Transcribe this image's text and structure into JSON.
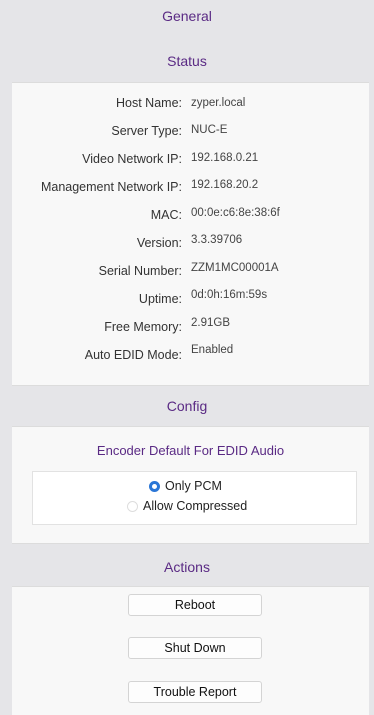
{
  "sections": {
    "general": "General",
    "status": "Status",
    "config": "Config",
    "actions": "Actions"
  },
  "status": {
    "rows": [
      {
        "label": "Host Name:",
        "value": "zyper.local"
      },
      {
        "label": "Server Type:",
        "value": "NUC-E"
      },
      {
        "label": "Video Network IP:",
        "value": "192.168.0.21"
      },
      {
        "label": "Management Network IP:",
        "value": "192.168.20.2"
      },
      {
        "label": "MAC:",
        "value": "00:0e:c6:8e:38:6f"
      },
      {
        "label": "Version:",
        "value": "3.3.39706"
      },
      {
        "label": "Serial Number:",
        "value": "ZZM1MC00001A"
      },
      {
        "label": "Uptime:",
        "value": "0d:0h:16m:59s"
      },
      {
        "label": "Free Memory:",
        "value": "2.91GB"
      },
      {
        "label": "Auto EDID Mode:",
        "value": "Enabled"
      }
    ]
  },
  "config": {
    "title": "Encoder Default For EDID Audio",
    "options": [
      {
        "label": "Only PCM",
        "selected": true
      },
      {
        "label": "Allow Compressed",
        "selected": false
      }
    ]
  },
  "actions": {
    "reboot": "Reboot",
    "shutdown": "Shut Down",
    "trouble_report": "Trouble Report"
  },
  "colors": {
    "heading": "#5a2a84",
    "radio_selected": "#2a76d6",
    "background": "#e5e5e8",
    "panel": "#f8f8f8"
  }
}
